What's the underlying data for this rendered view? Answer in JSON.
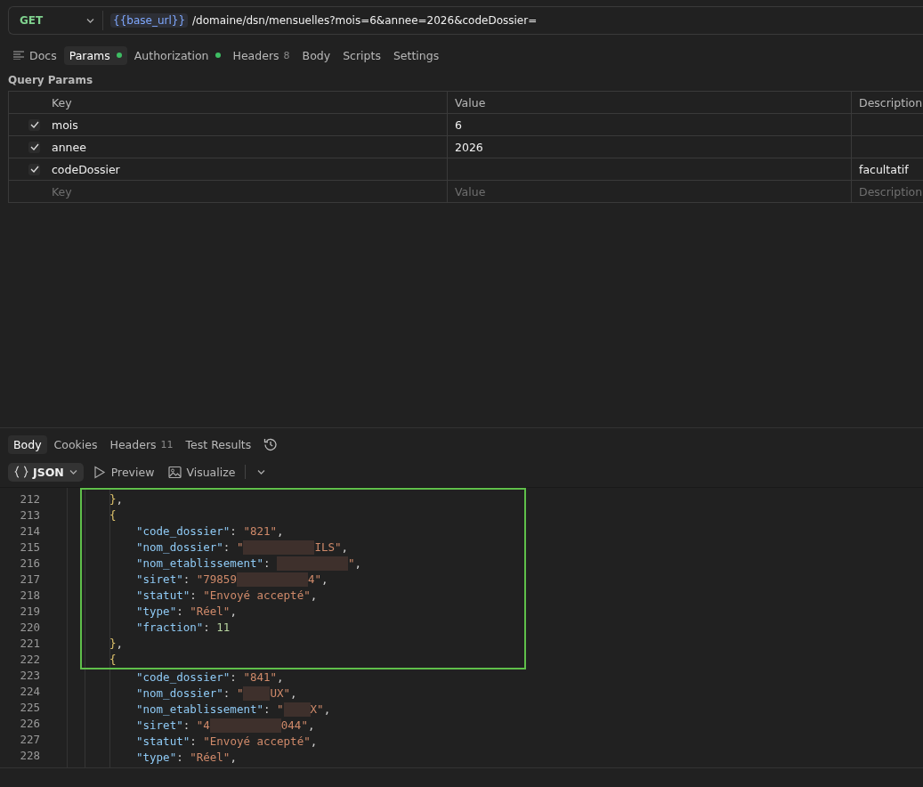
{
  "request": {
    "method": "GET",
    "variable": "{{base_url}}",
    "path": "/domaine/dsn/mensuelles?mois=6&annee=2026&codeDossier="
  },
  "request_tabs": [
    {
      "label": "Docs",
      "selected": false,
      "dot": false
    },
    {
      "label": "Params",
      "selected": true,
      "dot": true
    },
    {
      "label": "Authorization",
      "selected": false,
      "dot": true
    },
    {
      "label": "Headers",
      "count": "8",
      "selected": false,
      "dot": false
    },
    {
      "label": "Body",
      "selected": false,
      "dot": false
    },
    {
      "label": "Scripts",
      "selected": false,
      "dot": false
    },
    {
      "label": "Settings",
      "selected": false,
      "dot": false
    }
  ],
  "params": {
    "title": "Query Params",
    "columns": [
      "Key",
      "Value",
      "Description"
    ],
    "rows": [
      {
        "checked": true,
        "key": "mois",
        "value": "6",
        "description": ""
      },
      {
        "checked": true,
        "key": "annee",
        "value": "2026",
        "description": ""
      },
      {
        "checked": true,
        "key": "codeDossier",
        "value": "",
        "description": "facultatif"
      }
    ],
    "new_row": [
      {
        "placeholder": "Key"
      },
      {
        "placeholder": "Value"
      },
      {
        "placeholder": "Description"
      }
    ]
  },
  "response_tabs": [
    {
      "label": "Body",
      "selected": true
    },
    {
      "label": "Cookies",
      "selected": false
    },
    {
      "label": "Headers",
      "count": "11",
      "selected": false
    },
    {
      "label": "Test Results",
      "selected": false
    }
  ],
  "response_toolbar": {
    "format": "JSON",
    "buttons": [
      "Preview",
      "Visualize"
    ]
  },
  "code_blocks": [
    {
      "highlighted": true,
      "lines": [
        {
          "number": "212",
          "kind": "brace",
          "tokens": [
            {
              "kind": "brace",
              "text": "}"
            },
            {
              "kind": "punct",
              "text": ","
            }
          ]
        },
        {
          "number": "213",
          "kind": "brace",
          "tokens": [
            {
              "kind": "brace",
              "text": "{"
            }
          ]
        },
        {
          "number": "214",
          "kind": "property",
          "tokens": [
            {
              "kind": "key",
              "text": "\"code_dossier\""
            },
            {
              "kind": "punct",
              "text": ": "
            },
            {
              "kind": "string",
              "text": "\"821\""
            },
            {
              "kind": "punct",
              "text": ","
            }
          ]
        },
        {
          "number": "215",
          "kind": "property",
          "tokens": [
            {
              "kind": "key",
              "text": "\"nom_dossier\""
            },
            {
              "kind": "punct",
              "text": ": "
            },
            {
              "kind": "string",
              "text": "\""
            },
            {
              "kind": "redaction_wide"
            },
            {
              "kind": "string",
              "text": "ILS\""
            },
            {
              "kind": "punct",
              "text": ","
            }
          ]
        },
        {
          "number": "216",
          "kind": "property",
          "tokens": [
            {
              "kind": "key",
              "text": "\"nom_etablissement\""
            },
            {
              "kind": "punct",
              "text": ": "
            },
            {
              "kind": "redaction_wide"
            },
            {
              "kind": "string",
              "text": "\""
            },
            {
              "kind": "punct",
              "text": ","
            }
          ]
        },
        {
          "number": "217",
          "kind": "property",
          "tokens": [
            {
              "kind": "key",
              "text": "\"siret\""
            },
            {
              "kind": "punct",
              "text": ": "
            },
            {
              "kind": "string",
              "text": "\"79859"
            },
            {
              "kind": "redaction_wide"
            },
            {
              "kind": "string",
              "text": "4\""
            },
            {
              "kind": "punct",
              "text": ","
            }
          ]
        },
        {
          "number": "218",
          "kind": "property",
          "tokens": [
            {
              "kind": "key",
              "text": "\"statut\""
            },
            {
              "kind": "punct",
              "text": ": "
            },
            {
              "kind": "string",
              "text": "\"Envoyé accepté\""
            },
            {
              "kind": "punct",
              "text": ","
            }
          ]
        },
        {
          "number": "219",
          "kind": "property",
          "tokens": [
            {
              "kind": "key",
              "text": "\"type\""
            },
            {
              "kind": "punct",
              "text": ": "
            },
            {
              "kind": "string",
              "text": "\"Réel\""
            },
            {
              "kind": "punct",
              "text": ","
            }
          ]
        },
        {
          "number": "220",
          "kind": "property",
          "tokens": [
            {
              "kind": "key",
              "text": "\"fraction\""
            },
            {
              "kind": "punct",
              "text": ": "
            },
            {
              "kind": "number",
              "text": "11"
            }
          ]
        },
        {
          "number": "221",
          "kind": "brace",
          "tokens": [
            {
              "kind": "brace",
              "text": "}"
            },
            {
              "kind": "punct",
              "text": ","
            }
          ]
        },
        {
          "number": "222",
          "kind": "brace",
          "tokens": [
            {
              "kind": "brace",
              "text": "{"
            }
          ]
        }
      ]
    },
    {
      "highlighted": false,
      "lines": [
        {
          "number": "223",
          "kind": "property",
          "tokens": [
            {
              "kind": "key",
              "text": "\"code_dossier\""
            },
            {
              "kind": "punct",
              "text": ": "
            },
            {
              "kind": "string",
              "text": "\"841\""
            },
            {
              "kind": "punct",
              "text": ","
            }
          ]
        },
        {
          "number": "224",
          "kind": "property",
          "tokens": [
            {
              "kind": "key",
              "text": "\"nom_dossier\""
            },
            {
              "kind": "punct",
              "text": ": "
            },
            {
              "kind": "string",
              "text": "\""
            },
            {
              "kind": "redaction_narrow"
            },
            {
              "kind": "string",
              "text": "UX\""
            },
            {
              "kind": "punct",
              "text": ","
            }
          ]
        },
        {
          "number": "225",
          "kind": "property",
          "tokens": [
            {
              "kind": "key",
              "text": "\"nom_etablissement\""
            },
            {
              "kind": "punct",
              "text": ": "
            },
            {
              "kind": "string",
              "text": "\""
            },
            {
              "kind": "redaction_narrow"
            },
            {
              "kind": "string",
              "text": "X\""
            },
            {
              "kind": "punct",
              "text": ","
            }
          ]
        },
        {
          "number": "226",
          "kind": "property",
          "tokens": [
            {
              "kind": "key",
              "text": "\"siret\""
            },
            {
              "kind": "punct",
              "text": ": "
            },
            {
              "kind": "string",
              "text": "\"4"
            },
            {
              "kind": "redaction_wide"
            },
            {
              "kind": "string",
              "text": "044\""
            },
            {
              "kind": "punct",
              "text": ","
            }
          ]
        },
        {
          "number": "227",
          "kind": "property",
          "tokens": [
            {
              "kind": "key",
              "text": "\"statut\""
            },
            {
              "kind": "punct",
              "text": ": "
            },
            {
              "kind": "string",
              "text": "\"Envoyé accepté\""
            },
            {
              "kind": "punct",
              "text": ","
            }
          ]
        },
        {
          "number": "228",
          "kind": "property",
          "tokens": [
            {
              "kind": "key",
              "text": "\"type\""
            },
            {
              "kind": "punct",
              "text": ": "
            },
            {
              "kind": "string",
              "text": "\"Réel\""
            },
            {
              "kind": "punct",
              "text": ","
            }
          ]
        }
      ]
    }
  ]
}
